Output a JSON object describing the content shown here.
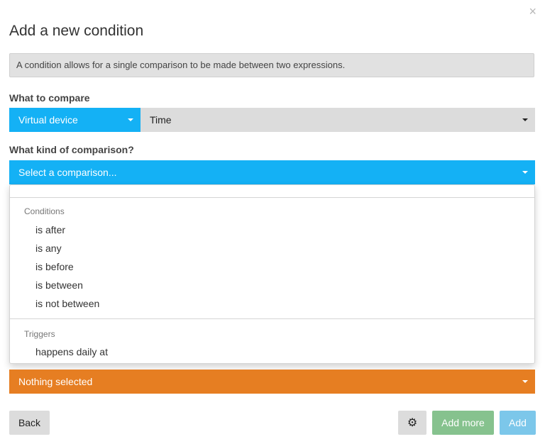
{
  "dialog": {
    "close_symbol": "×",
    "title": "Add a new condition",
    "info": "A condition allows for a single comparison to be made between two expressions."
  },
  "compare": {
    "label": "What to compare",
    "source_value": "Virtual device",
    "target_value": "Time"
  },
  "comparison": {
    "label": "What kind of comparison?",
    "placeholder": "Select a comparison..."
  },
  "dropdown": {
    "groups": [
      {
        "header": "Conditions",
        "items": [
          "is after",
          "is any",
          "is before",
          "is between",
          "is not between"
        ]
      },
      {
        "header": "Triggers",
        "items": [
          "happens daily at"
        ]
      }
    ]
  },
  "value_select": {
    "value": "Nothing selected"
  },
  "footer": {
    "back_label": "Back",
    "gear_icon": "gear-icon",
    "add_more_label": "Add more",
    "add_label": "Add"
  },
  "colors": {
    "accent_blue": "#14b1f5",
    "accent_orange": "#e67e22",
    "add_more_green": "#86c28e",
    "add_blue": "#7cc7ea",
    "neutral_grey": "#dcdcdc"
  }
}
